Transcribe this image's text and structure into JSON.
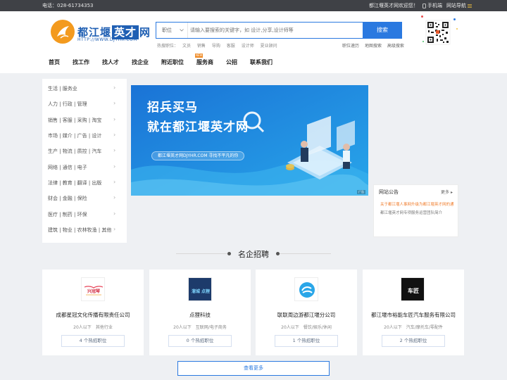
{
  "topbar": {
    "phone": "电话：028-61734353",
    "welcome": "都江堰英才网欢迎您！",
    "mobile": "手机端",
    "site_nav": "网站导航"
  },
  "logo": {
    "text_a": "都江堰",
    "text_b": "英才",
    "text_c": "网",
    "url": "HTTP://WWW.DJYHR.COM"
  },
  "search": {
    "type": "职位",
    "placeholder": "请输入要搜索的关键字，如 设计,分享,设计师等",
    "button": "搜索",
    "hot_label": "热搜职位：",
    "hot_items": [
      "文员",
      "销售",
      "导购",
      "客服",
      "设计师",
      "夏业顾问"
    ]
  },
  "quick_links": [
    "职位速历",
    "地图搜索",
    "高级搜索"
  ],
  "nav": {
    "items": [
      "首页",
      "找工作",
      "找人才",
      "找企业",
      "附近职位",
      "服务商",
      "公招",
      "联系我们"
    ],
    "badge": "NEW"
  },
  "categories": [
    "生活 | 服务业",
    "人力 | 行政 | 管理",
    "销售 | 客服 | 采购 | 淘宝",
    "市场 | 媒介 | 广告 | 设计",
    "生产 | 物流 | 质控 | 汽车",
    "网络 | 通信 | 电子",
    "法律 | 教育 | 翻译 | 出版",
    "财会 | 金融 | 保险",
    "医疗 | 制药 | 环保",
    "建筑 | 物业 | 农林牧渔 | 其他"
  ],
  "banner": {
    "line1": "招兵买马",
    "line2": "就在都江堰英才网",
    "pill": "都江堰英才网DJYHR.COM 寻找不平凡的你",
    "ad_tag": "广告"
  },
  "notice": {
    "title": "网站公告",
    "more": "更多",
    "items": [
      "关于都江堰人事网升级为都江堰英才网的通知",
      "都江堰英才网专项服务运营团队简介"
    ]
  },
  "section": {
    "title": "名企招聘"
  },
  "companies": [
    {
      "logo_text": "兴冠琴",
      "name": "成都星冠文化传播有限责任公司",
      "size": "20人以下",
      "industry": "其他行业",
      "jobs": "4",
      "jobs_label": "个热招职位"
    },
    {
      "logo_text": "溜城 点狸",
      "name": "点狸科技",
      "size": "20人以下",
      "industry": "互联网/电子商务",
      "jobs": "0",
      "jobs_label": "个热招职位"
    },
    {
      "logo_text": "",
      "name": "联联周边游都江堰分公司",
      "size": "20人以下",
      "industry": "餐饮/娱乐/休闲",
      "jobs": "1",
      "jobs_label": "个热招职位"
    },
    {
      "logo_text": "车匠",
      "name": "都江堰市裕能车匠汽车服务有限公司",
      "size": "20人以下",
      "industry": "汽车/摩托车/零配件",
      "jobs": "2",
      "jobs_label": "个热招职位"
    }
  ],
  "more_button": "查看更多",
  "colors": {
    "brand_blue": "#2a79e0",
    "accent_orange": "#f08a24",
    "topbar_bg": "#3f4146",
    "page_bg": "#eef0f3"
  },
  "icons": [
    "phone-icon",
    "menu-icon",
    "chevron-down-icon",
    "chevron-right-icon",
    "qr-code-icon"
  ]
}
